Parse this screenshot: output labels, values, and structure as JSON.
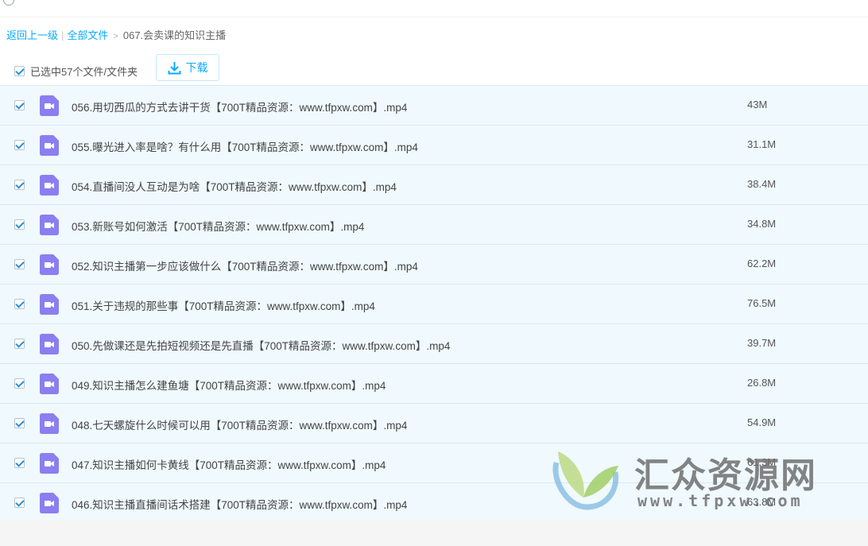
{
  "breadcrumb": {
    "back": "返回上一级",
    "all_files": "全部文件",
    "current": "067.会卖课的知识主播"
  },
  "toolbar": {
    "selection_text": "已选中57个文件/文件夹",
    "download_label": "下载"
  },
  "files": [
    {
      "name": "056.用切西瓜的方式去讲干货【700T精品资源：www.tfpxw.com】.mp4",
      "size": "43M",
      "checked": true
    },
    {
      "name": "055.曝光进入率是啥？有什么用【700T精品资源：www.tfpxw.com】.mp4",
      "size": "31.1M",
      "checked": true
    },
    {
      "name": "054.直播间没人互动是为啥【700T精品资源：www.tfpxw.com】.mp4",
      "size": "38.4M",
      "checked": true
    },
    {
      "name": "053.新账号如何激活【700T精品资源：www.tfpxw.com】.mp4",
      "size": "34.8M",
      "checked": true
    },
    {
      "name": "052.知识主播第一步应该做什么【700T精品资源：www.tfpxw.com】.mp4",
      "size": "62.2M",
      "checked": true
    },
    {
      "name": "051.关于违规的那些事【700T精品资源：www.tfpxw.com】.mp4",
      "size": "76.5M",
      "checked": true
    },
    {
      "name": "050.先做课还是先拍短视频还是先直播【700T精品资源：www.tfpxw.com】.mp4",
      "size": "39.7M",
      "checked": true
    },
    {
      "name": "049.知识主播怎么建鱼塘【700T精品资源：www.tfpxw.com】.mp4",
      "size": "26.8M",
      "checked": true
    },
    {
      "name": "048.七天螺旋什么时候可以用【700T精品资源：www.tfpxw.com】.mp4",
      "size": "54.9M",
      "checked": true
    },
    {
      "name": "047.知识主播如何卡黄线【700T精品资源：www.tfpxw.com】.mp4",
      "size": "61.3M",
      "checked": true
    },
    {
      "name": "046.知识主播直播间话术搭建【700T精品资源：www.tfpxw.com】.mp4",
      "size": "63.8M",
      "checked": true
    }
  ],
  "watermark": {
    "title": "汇众资源网",
    "url": "www.tfpxw.com"
  },
  "colors": {
    "link": "#09aaff",
    "row_bg": "#f0f9fd",
    "video_icon": "#8b7ef0"
  },
  "icons": {
    "checkbox": "checkbox-checked-icon",
    "file_type": "video-file-icon",
    "download": "download-icon"
  }
}
